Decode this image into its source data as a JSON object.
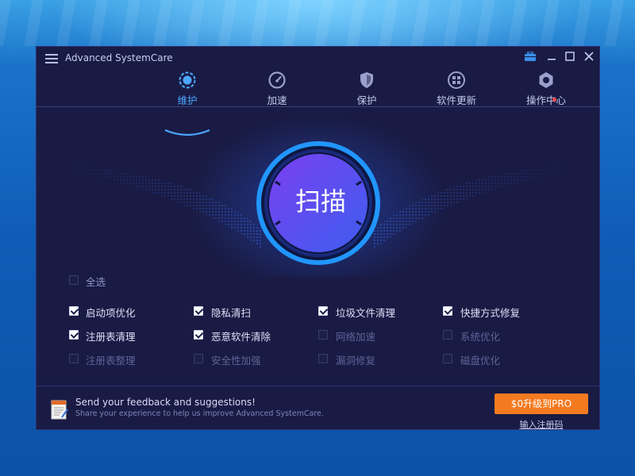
{
  "app": {
    "title": "Advanced SystemCare"
  },
  "tabs": [
    {
      "label": "维护",
      "icon": "maintenance-icon",
      "active": true
    },
    {
      "label": "加速",
      "icon": "speedometer-icon",
      "active": false
    },
    {
      "label": "保护",
      "icon": "shield-icon",
      "active": false
    },
    {
      "label": "软件更新",
      "icon": "apps-update-icon",
      "active": false
    },
    {
      "label": "操作中心",
      "icon": "action-center-icon",
      "active": false,
      "notification": true
    }
  ],
  "scan": {
    "label": "扫描"
  },
  "select_all": {
    "label": "全选",
    "checked": false
  },
  "items": [
    {
      "label": "启动项优化",
      "checked": true
    },
    {
      "label": "隐私清扫",
      "checked": true
    },
    {
      "label": "垃圾文件清理",
      "checked": true
    },
    {
      "label": "快捷方式修复",
      "checked": true
    },
    {
      "label": "注册表清理",
      "checked": true
    },
    {
      "label": "恶意软件清除",
      "checked": true
    },
    {
      "label": "网络加速",
      "checked": false
    },
    {
      "label": "系统优化",
      "checked": false
    },
    {
      "label": "注册表整理",
      "checked": false
    },
    {
      "label": "安全性加强",
      "checked": false
    },
    {
      "label": "漏洞修复",
      "checked": false
    },
    {
      "label": "磁盘优化",
      "checked": false
    }
  ],
  "feedback": {
    "title": "Send your feedback and suggestions!",
    "subtitle": "Share your experience to help us improve Advanced SystemCare."
  },
  "upgrade": {
    "label": "$0升级到PRO"
  },
  "register": {
    "label": "输入注册码"
  },
  "colors": {
    "accent": "#4da6ff",
    "window_bg": "#191b44",
    "upgrade": "#f47a1f"
  }
}
